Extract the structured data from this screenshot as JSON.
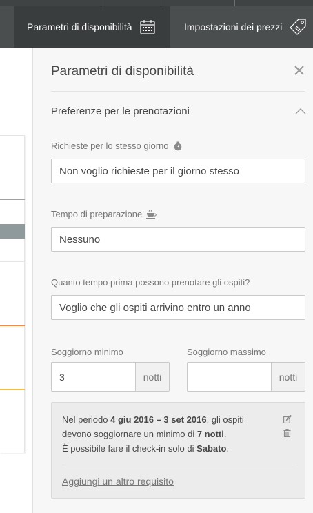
{
  "toolbar": {
    "tabs": [
      {
        "label": "Parametri di disponibilità",
        "icon": "calendar-icon",
        "active": true
      },
      {
        "label": "Impostazioni dei prezzi",
        "icon": "price-tag-icon",
        "active": false
      }
    ]
  },
  "panel": {
    "title": "Parametri di disponibilità",
    "close_icon": "close-icon",
    "section": {
      "title": "Preferenze per le prenotazioni",
      "icon": "chevron-up-icon"
    },
    "same_day": {
      "label": "Richieste per lo stesso giorno",
      "icon": "stopwatch-icon",
      "value": "Non voglio richieste per il giorno stesso"
    },
    "prep_time": {
      "label": "Tempo di preparazione",
      "icon": "coffee-cup-icon",
      "value": "Nessuno"
    },
    "advance": {
      "label": "Quanto tempo prima possono prenotare gli ospiti?",
      "value": "Voglio che gli ospiti arrivino entro un anno"
    },
    "min_stay": {
      "label": "Soggiorno minimo",
      "value": "3",
      "suffix": "notti"
    },
    "max_stay": {
      "label": "Soggiorno massimo",
      "value": "",
      "suffix": "notti"
    },
    "requirement": {
      "p1": "Nel periodo ",
      "period": "4 giu 2016 – 3 set 2016",
      "p2": ", gli ospiti devono soggiornare un minimo di ",
      "nights": "7 notti",
      "p3": ".",
      "p4": "È possibile fare il check-in solo di ",
      "day": "Sabato",
      "p5": ".",
      "edit_icon": "pencil-icon",
      "delete_icon": "trash-icon",
      "add_link": "Aggiungi un altro requisito"
    }
  },
  "colors": {
    "toolbar_bg": "#4a4e4f",
    "active_tab_bg": "#393d3e",
    "panel_bg": "#f7f7f7",
    "accent_orange": "#f08a4b",
    "accent_yellow": "#f6c142",
    "calendar_gray_bar": "#8e9a9c"
  }
}
